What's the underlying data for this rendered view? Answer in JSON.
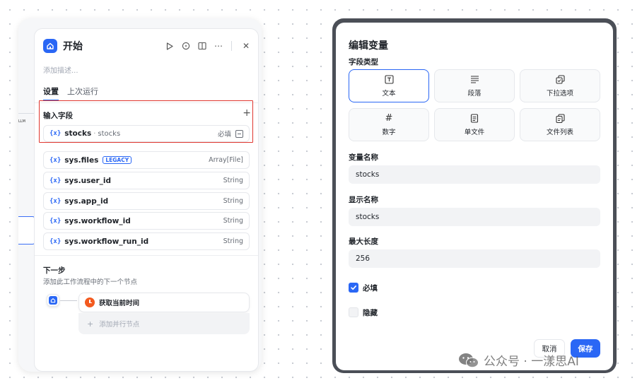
{
  "canvas": {
    "peek_label": "LLM"
  },
  "start_panel": {
    "title": "开始",
    "description_placeholder": "添加描述...",
    "tabs": [
      {
        "label": "设置",
        "active": true
      },
      {
        "label": "上次运行",
        "active": false
      }
    ],
    "input_section_title": "输入字段",
    "input_fields": [
      {
        "icon": "{x}",
        "name": "stocks",
        "label": "stocks",
        "required": "必填"
      }
    ],
    "system_vars": [
      {
        "icon": "{x}",
        "name": "sys.files",
        "badge": "LEGACY",
        "type": "Array[File]"
      },
      {
        "icon": "{x}",
        "name": "sys.user_id",
        "type": "String"
      },
      {
        "icon": "{x}",
        "name": "sys.app_id",
        "type": "String"
      },
      {
        "icon": "{x}",
        "name": "sys.workflow_id",
        "type": "String"
      },
      {
        "icon": "{x}",
        "name": "sys.workflow_run_id",
        "type": "String"
      }
    ],
    "next_step": {
      "title": "下一步",
      "description": "添加此工作流程中的下一个节点",
      "next_node": "获取当前时间",
      "add_parallel": "添加并行节点"
    }
  },
  "edit_dialog": {
    "title": "编辑变量",
    "field_type_label": "字段类型",
    "field_types": [
      {
        "label": "文本",
        "icon": "text-icon",
        "selected": true
      },
      {
        "label": "段落",
        "icon": "paragraph-icon",
        "selected": false
      },
      {
        "label": "下拉选项",
        "icon": "select-icon",
        "selected": false
      },
      {
        "label": "数字",
        "icon": "hash-icon",
        "selected": false
      },
      {
        "label": "单文件",
        "icon": "file-icon",
        "selected": false
      },
      {
        "label": "文件列表",
        "icon": "file-list-icon",
        "selected": false
      }
    ],
    "variable_name_label": "变量名称",
    "variable_name_value": "stocks",
    "display_name_label": "显示名称",
    "display_name_value": "stocks",
    "max_length_label": "最大长度",
    "max_length_value": "256",
    "required_label": "必填",
    "required_checked": true,
    "hidden_label": "隐藏",
    "hidden_checked": false,
    "cancel_label": "取消",
    "save_label": "保存"
  },
  "watermark": {
    "text": "公众号 · 一漾思AI"
  },
  "colors": {
    "accent": "#2a67f5",
    "highlight": "#e0362f",
    "clock": "#f35a1f"
  }
}
